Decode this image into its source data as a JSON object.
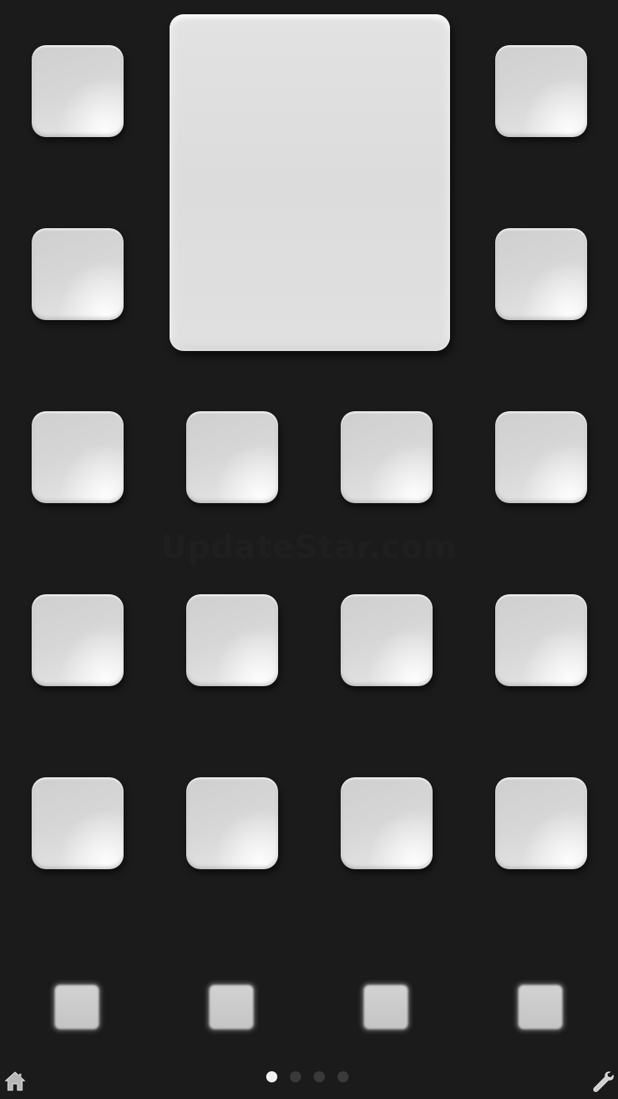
{
  "watermark": "UpdateStar.com",
  "colors": {
    "background": "#1b1b1b",
    "tile": "#d8d8d8",
    "dot_active": "#f2f2f2",
    "dot_inactive": "#3a3a3a"
  },
  "home_screen": {
    "widget": {
      "name": "large-widget-placeholder"
    },
    "icon_rows": 5,
    "icon_columns": 4,
    "dock_icon_count": 4
  },
  "pager": {
    "page_count": 4,
    "current_page": 1
  },
  "icons": {
    "left_corner": "home-icon",
    "right_corner": "wrench-icon"
  }
}
